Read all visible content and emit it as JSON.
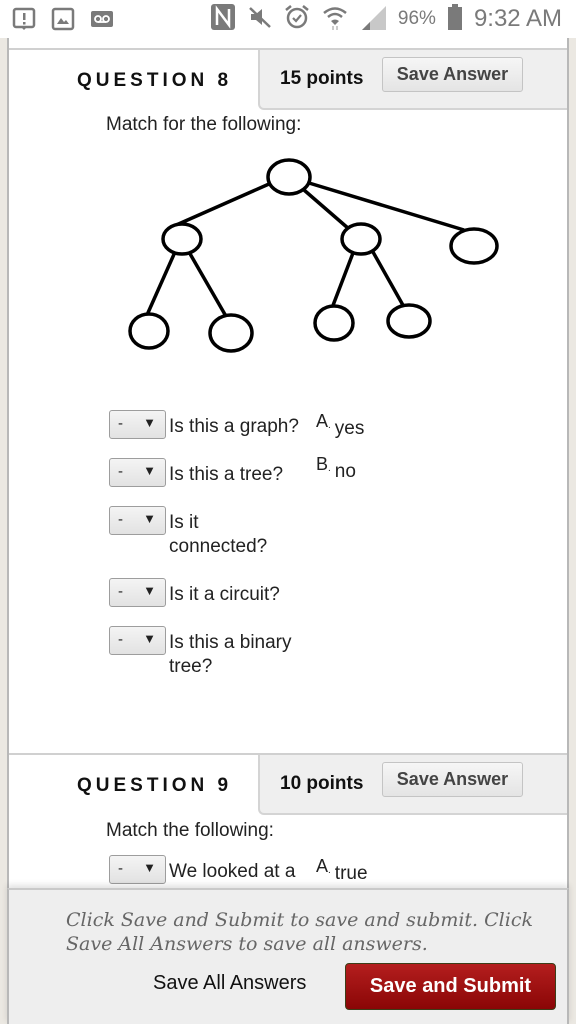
{
  "statusbar": {
    "left_icons": [
      "alert-notification-icon",
      "image-notification-icon",
      "voicemail-icon"
    ],
    "right_icons": [
      "nfc-icon",
      "mute-icon",
      "alarm-icon",
      "wifi-icon",
      "signal-icon"
    ],
    "battery": "96%",
    "time": "9:32 AM"
  },
  "questions": [
    {
      "title": "QUESTION 8",
      "points": "15 points",
      "save_label": "Save Answer",
      "prompt": "Match for the following:",
      "diagram": "tree-graph",
      "items": [
        {
          "selected": "-",
          "text": "Is this a graph?"
        },
        {
          "selected": "-",
          "text": "Is this a tree?"
        },
        {
          "selected": "-",
          "text": "Is it connected?"
        },
        {
          "selected": "-",
          "text": "Is it a circuit?"
        },
        {
          "selected": "-",
          "text": "Is this a binary tree?"
        }
      ],
      "options": [
        {
          "letter": "A",
          "text": "yes"
        },
        {
          "letter": "B",
          "text": "no"
        }
      ]
    },
    {
      "title": "QUESTION 9",
      "points": "10 points",
      "save_label": "Save Answer",
      "prompt": "Match the following:",
      "items": [
        {
          "selected": "-",
          "text": "We looked at a"
        }
      ],
      "options": [
        {
          "letter": "A",
          "text": "true"
        }
      ]
    }
  ],
  "footer": {
    "note": "Click Save and Submit to save and submit. Click Save All Answers to save all answers.",
    "save_all_label": "Save All Answers",
    "submit_label": "Save and Submit",
    "submit_color": "#9e1212"
  }
}
